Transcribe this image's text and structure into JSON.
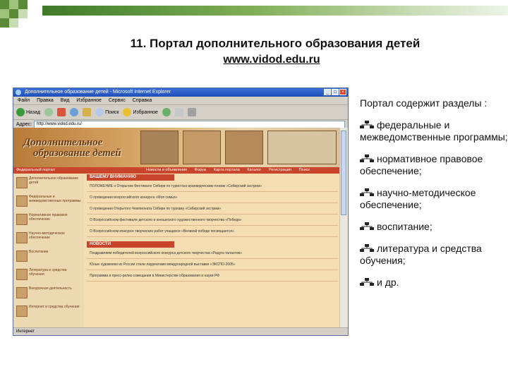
{
  "slide": {
    "title": "11. Портал дополнительного образования детей",
    "url": "www.vidod.edu.ru",
    "intro": "Портал содержит разделы :",
    "bullets": [
      "федеральные и межведомственные программы;",
      "нормативное правовое обеспечение;",
      "научно-методическое обеспечение;",
      "воспитание;",
      "литература и средства обучения;",
      "и др."
    ]
  },
  "browser": {
    "window_title": "Дополнительное образование детей - Microsoft Internet Explorer",
    "menu": [
      "Файл",
      "Правка",
      "Вид",
      "Избранное",
      "Сервис",
      "Справка"
    ],
    "toolbar": {
      "back": "Назад",
      "search": "Поиск",
      "favorites": "Избранное"
    },
    "address_label": "Адрес:",
    "address_value": "http://www.vidod.edu.ru/",
    "status": "Интернет",
    "page": {
      "logo_line1": "Дополнительное",
      "logo_line2": "образование детей",
      "nav_left": "Федеральный портал",
      "nav_items": [
        "Новости и объявления",
        "Форум",
        "Карта портала",
        "Каталог",
        "Регистрация",
        "Поиск"
      ],
      "side_items": [
        "Дополнительное образование детей",
        "Федеральные и межведомственные программы",
        "Нормативное правовое обеспечение",
        "Научно-методическое обеспечение",
        "Воспитание",
        "Литература и средства обучения",
        "Внеурочная деятельность",
        "Интернет и средства обучения"
      ],
      "section1": "ВАШЕМУ ВНИМАНИЮ",
      "notices": [
        "ПОЛОЖЕНИЕ о Открытом Фестивале Сибири по туристско-краеведческим гонкам «Сибирский экстрим»",
        "О проведении всероссийского конкурса «Моя семья»",
        "О проведении Открытого Чемпионата Сибири по туризму «Сибирский экстрим»",
        "О Всероссийском фестивале детского и юношеского художественного творчества «Победа»",
        "О Всероссийском конкурсе творческих работ учащихся «Великой победе посвящается»"
      ],
      "section2": "НОВОСТИ",
      "news": [
        "Поздравляем победителей всероссийского конкурса детского творчества «Радуга талантов»",
        "Юные художники из России стали лауреатами международной выставки «ЭКСПО-2005»",
        "Программа и пресс-релиз совещания в Министерстве образования и науки РФ"
      ]
    }
  },
  "colors": {
    "accent_red": "#c8442a",
    "page_bg": "#f3ddb1",
    "deco_green": "#5a8a35"
  }
}
